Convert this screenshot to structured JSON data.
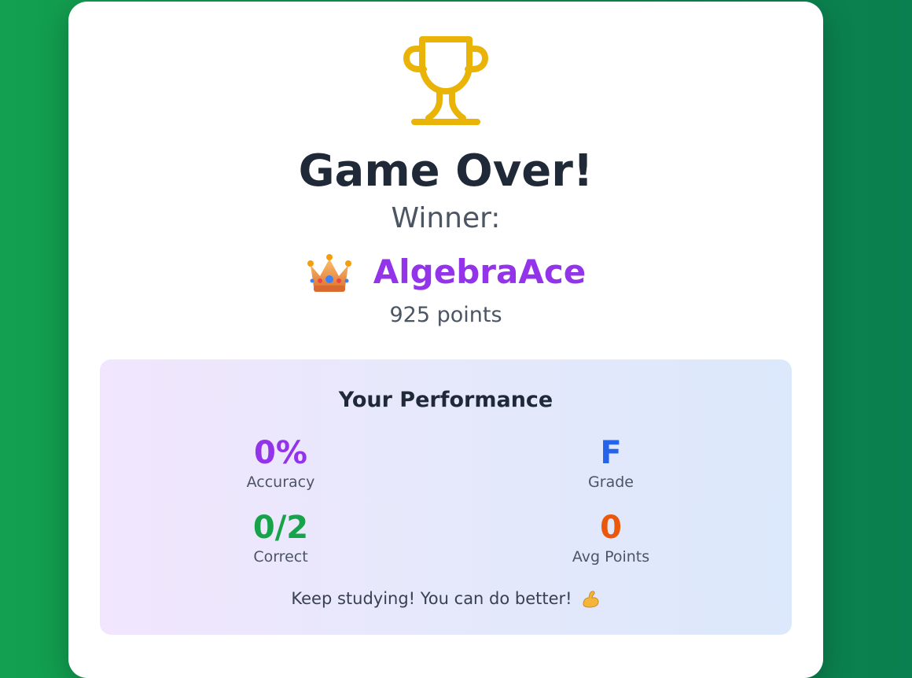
{
  "result": {
    "title": "Game Over!",
    "winner_label": "Winner:",
    "winner_name": "AlgebraAce",
    "winner_points": "925 points",
    "trophy_icon": "trophy-icon",
    "crown_icon": "crown-icon"
  },
  "performance": {
    "title": "Your Performance",
    "stats": [
      {
        "value": "0%",
        "label": "Accuracy",
        "color": "#9333ea"
      },
      {
        "value": "F",
        "label": "Grade",
        "color": "#2563eb"
      },
      {
        "value": "0/2",
        "label": "Correct",
        "color": "#16a34a"
      },
      {
        "value": "0",
        "label": "Avg Points",
        "color": "#ea580c"
      }
    ],
    "message": "Keep studying! You can do better!",
    "message_icon": "flexed-biceps-icon"
  },
  "colors": {
    "background": "#0d8f4d",
    "trophy": "#eab308",
    "winner_name": "#9333ea"
  }
}
